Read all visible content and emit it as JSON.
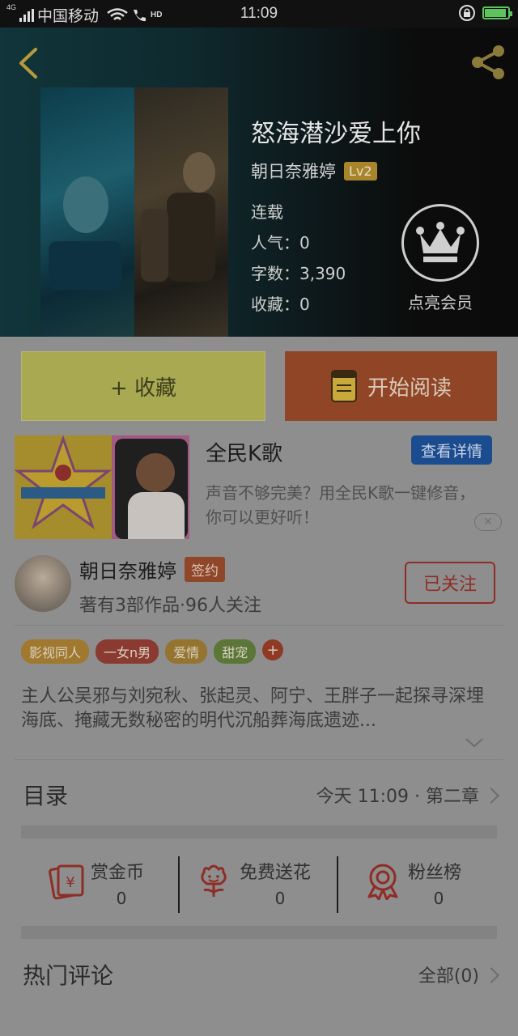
{
  "status_bar": {
    "network": "4G",
    "carrier": "中国移动",
    "hd": "HD",
    "time": "11:09"
  },
  "header": {
    "back_icon": "chevron-left-icon",
    "share_icon": "share-icon"
  },
  "book": {
    "title": "怒海潜沙爱上你",
    "author": "朝日奈雅婷",
    "level": "Lv2",
    "status": "连载",
    "popularity": "人气：0",
    "word_count": "字数：3,390",
    "favorites": "收藏：0",
    "vip_label": "点亮会员"
  },
  "buttons": {
    "collect": "+ 收藏",
    "read": "开始阅读"
  },
  "ad": {
    "title": "全民K歌",
    "detail_button": "查看详情",
    "description": "声音不够完美？用全民K歌一键修音，你可以更好听！",
    "close": "✕"
  },
  "author_card": {
    "name": "朝日奈雅婷",
    "badge": "签约",
    "stats": "著有3部作品·96人关注",
    "follow_button": "已关注"
  },
  "tags": [
    {
      "label": "影视同人",
      "color": "#a0782e"
    },
    {
      "label": "一女n男",
      "color": "#8a3a30"
    },
    {
      "label": "爱情",
      "color": "#94742e"
    },
    {
      "label": "甜宠",
      "color": "#5b7636"
    }
  ],
  "tags_more": "+",
  "synopsis": "主人公吴邪与刘宛秋、张起灵、阿宁、王胖子一起探寻深埋海底、掩藏无数秘密的明代沉船葬海底遗迹...",
  "toc": {
    "label": "目录",
    "latest": "今天 11:09 · 第二章"
  },
  "actions": [
    {
      "label": "赏金币",
      "value": "0",
      "icon": "red-envelope-icon"
    },
    {
      "label": "免费送花",
      "value": "0",
      "icon": "flower-icon"
    },
    {
      "label": "粉丝榜",
      "value": "0",
      "icon": "medal-icon"
    }
  ],
  "comments": {
    "label": "热门评论",
    "all": "全部(0)"
  }
}
